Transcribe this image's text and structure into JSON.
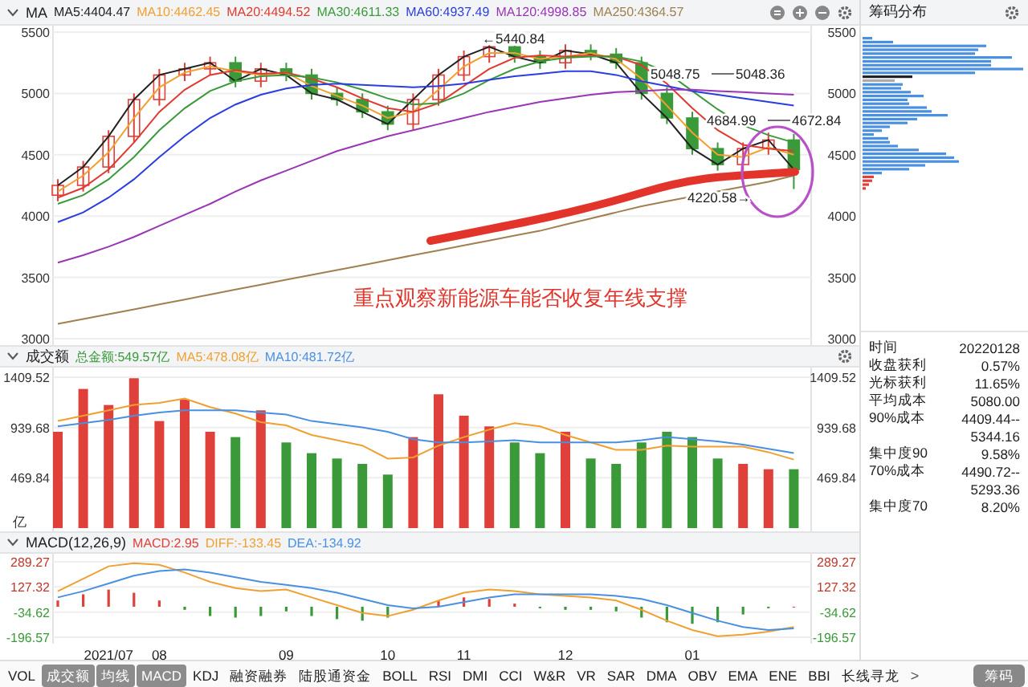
{
  "price_panel": {
    "title": "MA",
    "legend": [
      {
        "text": "MA5:4404.47",
        "color": "#222222"
      },
      {
        "text": "MA10:4462.45",
        "color": "#f0a030"
      },
      {
        "text": "MA20:4494.52",
        "color": "#e03a30"
      },
      {
        "text": "MA30:4611.33",
        "color": "#3a9a3a"
      },
      {
        "text": "MA60:4937.49",
        "color": "#2a3ee0"
      },
      {
        "text": "MA120:4998.85",
        "color": "#9a35b5"
      },
      {
        "text": "MA250:4364.57",
        "color": "#a08050"
      }
    ],
    "price_markers": [
      {
        "texts": [
          "←5440.84"
        ]
      },
      {
        "texts": [
          "5048.75",
          "5048.36"
        ]
      },
      {
        "texts": [
          "4684.99",
          "4672.84"
        ]
      },
      {
        "texts": [
          "4220.58→"
        ]
      }
    ],
    "note": "重点观察新能源车能否收复年线支撑",
    "right_axis_labels": [
      "5500",
      "5000",
      "4500",
      "4000",
      "3500",
      "3000"
    ],
    "chart_data": {
      "type": "candlestick",
      "ylim": [
        3000,
        5500
      ],
      "yticks": [
        5500,
        5000,
        4500,
        4000,
        3500,
        3000
      ],
      "grid": true,
      "ohlc": [
        [
          4170,
          4300,
          4120,
          4250
        ],
        [
          4250,
          4450,
          4200,
          4400
        ],
        [
          4400,
          4700,
          4350,
          4650
        ],
        [
          4650,
          5000,
          4600,
          4950
        ],
        [
          4950,
          5200,
          4900,
          5150
        ],
        [
          5150,
          5250,
          5100,
          5200
        ],
        [
          5200,
          5300,
          5150,
          5250
        ],
        [
          5250,
          5300,
          5050,
          5100
        ],
        [
          5100,
          5250,
          5050,
          5200
        ],
        [
          5200,
          5250,
          5100,
          5150
        ],
        [
          5150,
          5200,
          4950,
          5000
        ],
        [
          5000,
          5050,
          4900,
          4950
        ],
        [
          4950,
          5000,
          4800,
          4850
        ],
        [
          4850,
          4900,
          4700,
          4750
        ],
        [
          4750,
          5000,
          4700,
          4950
        ],
        [
          4950,
          5200,
          4900,
          5150
        ],
        [
          5150,
          5350,
          5100,
          5300
        ],
        [
          5300,
          5440,
          5250,
          5380
        ],
        [
          5380,
          5430,
          5250,
          5300
        ],
        [
          5300,
          5350,
          5200,
          5250
        ],
        [
          5250,
          5400,
          5200,
          5350
        ],
        [
          5350,
          5400,
          5270,
          5320
        ],
        [
          5320,
          5370,
          5200,
          5250
        ],
        [
          5250,
          5300,
          4950,
          5000
        ],
        [
          5000,
          5050,
          4750,
          4800
        ],
        [
          4800,
          4850,
          4500,
          4550
        ],
        [
          4550,
          4600,
          4370,
          4420
        ],
        [
          4420,
          4600,
          4370,
          4550
        ],
        [
          4550,
          4680,
          4500,
          4620
        ],
        [
          4620,
          4670,
          4220,
          4380
        ]
      ],
      "series": [
        {
          "type": "line",
          "color": "#222222",
          "values": [
            4250,
            4400,
            4650,
            4950,
            5150,
            5200,
            5250,
            5100,
            5200,
            5150,
            5000,
            4950,
            4850,
            4750,
            4950,
            5150,
            5300,
            5380,
            5300,
            5250,
            5350,
            5320,
            5250,
            5000,
            4800,
            4550,
            4420,
            4550,
            4620,
            4380
          ]
        },
        {
          "type": "line",
          "color": "#f0a030",
          "values": [
            4200,
            4330,
            4520,
            4800,
            5050,
            5170,
            5220,
            5180,
            5150,
            5170,
            5060,
            4980,
            4900,
            4800,
            4850,
            5030,
            5220,
            5330,
            5330,
            5280,
            5300,
            5330,
            5280,
            5120,
            4900,
            4680,
            4500,
            4480,
            4560,
            4500
          ]
        },
        {
          "type": "line",
          "color": "#e03a30",
          "values": [
            4150,
            4230,
            4380,
            4600,
            4850,
            5030,
            5150,
            5190,
            5160,
            5170,
            5120,
            5050,
            4960,
            4880,
            4850,
            4920,
            5060,
            5200,
            5290,
            5310,
            5300,
            5310,
            5300,
            5230,
            5080,
            4880,
            4700,
            4580,
            4550,
            4530
          ]
        },
        {
          "type": "line",
          "color": "#3a9a3a",
          "values": [
            4100,
            4170,
            4300,
            4480,
            4700,
            4880,
            5020,
            5100,
            5140,
            5150,
            5130,
            5090,
            5030,
            4960,
            4910,
            4920,
            5000,
            5110,
            5200,
            5260,
            5290,
            5300,
            5300,
            5260,
            5170,
            5020,
            4870,
            4740,
            4660,
            4600
          ]
        },
        {
          "type": "line",
          "color": "#2a3ee0",
          "values": [
            3950,
            4030,
            4150,
            4300,
            4480,
            4650,
            4800,
            4910,
            4990,
            5040,
            5070,
            5080,
            5070,
            5060,
            5050,
            5060,
            5080,
            5110,
            5140,
            5160,
            5180,
            5180,
            5150,
            5100,
            5060,
            5020,
            4990,
            4960,
            4930,
            4900
          ]
        },
        {
          "type": "line",
          "color": "#9a35b5",
          "values": [
            3620,
            3680,
            3750,
            3830,
            3920,
            4010,
            4100,
            4200,
            4290,
            4370,
            4450,
            4530,
            4590,
            4650,
            4700,
            4750,
            4800,
            4850,
            4890,
            4930,
            4960,
            4990,
            5010,
            5020,
            5030,
            5030,
            5020,
            5010,
            5000,
            4990
          ]
        },
        {
          "type": "line",
          "color": "#a08050",
          "values": [
            3120,
            3160,
            3200,
            3240,
            3280,
            3320,
            3360,
            3400,
            3440,
            3480,
            3520,
            3560,
            3600,
            3640,
            3680,
            3720,
            3760,
            3800,
            3840,
            3880,
            3930,
            3980,
            4030,
            4080,
            4120,
            4160,
            4200,
            4240,
            4280,
            4330
          ]
        }
      ]
    }
  },
  "volume_panel": {
    "title": "成交额",
    "legend": [
      {
        "text": "总金额:549.57亿",
        "color": "#3a9a3a"
      },
      {
        "text": "MA5:478.08亿",
        "color": "#f0a030"
      },
      {
        "text": "MA10:481.72亿",
        "color": "#4a90e0"
      }
    ],
    "unit": "亿",
    "right_axis_labels": [
      "1409.52",
      "939.68",
      "469.84"
    ],
    "chart_data": {
      "type": "bar",
      "ylim": [
        0,
        1409.52
      ],
      "yticks": [
        1409.52,
        939.68,
        469.84
      ],
      "grid": true,
      "series": [
        {
          "color": "#e0403a",
          "values": [
            900,
            1300,
            1150,
            1400,
            1000,
            1200,
            900,
            null,
            1100,
            null,
            null,
            null,
            null,
            null,
            850,
            1250,
            1050,
            950,
            null,
            null,
            900,
            null,
            null,
            null,
            null,
            null,
            null,
            600,
            550,
            null
          ]
        },
        {
          "color": "#3a9a3a",
          "values": [
            null,
            null,
            null,
            null,
            null,
            null,
            null,
            850,
            null,
            800,
            700,
            650,
            600,
            500,
            null,
            null,
            null,
            null,
            800,
            700,
            null,
            650,
            600,
            800,
            900,
            850,
            650,
            null,
            null,
            550
          ]
        },
        {
          "type": "line",
          "color": "#f0a030",
          "values": [
            1000,
            1050,
            1100,
            1150,
            1170,
            1210,
            1130,
            1070,
            990,
            960,
            870,
            820,
            770,
            650,
            660,
            770,
            850,
            920,
            980,
            950,
            870,
            800,
            730,
            730,
            770,
            760,
            760,
            760,
            710,
            640
          ]
        },
        {
          "type": "line",
          "color": "#4a90e0",
          "values": [
            950,
            980,
            1010,
            1050,
            1080,
            1100,
            1100,
            1100,
            1080,
            1060,
            1000,
            970,
            940,
            900,
            830,
            800,
            800,
            810,
            820,
            800,
            800,
            800,
            800,
            820,
            850,
            830,
            810,
            780,
            740,
            700
          ]
        }
      ]
    }
  },
  "macd_panel": {
    "title": "MACD(12,26,9)",
    "legend": [
      {
        "text": "MACD:2.95",
        "color": "#e0403a"
      },
      {
        "text": "DIFF:-133.45",
        "color": "#f0a030"
      },
      {
        "text": "DEA:-134.92",
        "color": "#4a90e0"
      }
    ],
    "right_axis_labels": [
      "289.27",
      "127.32",
      "-34.62",
      "-196.57"
    ],
    "chart_data": {
      "type": "bar",
      "ylim": [
        -196.57,
        289.27
      ],
      "grid": true,
      "yticks": [
        289.27,
        127.32,
        -34.62,
        -196.57
      ],
      "categories": [
        null,
        null,
        "2021/07",
        null,
        "08",
        null,
        null,
        null,
        null,
        "09",
        null,
        null,
        null,
        "10",
        null,
        null,
        "11",
        null,
        null,
        null,
        "12",
        null,
        null,
        null,
        null,
        "01",
        null,
        null,
        null,
        null
      ],
      "series": [
        {
          "color": "#e0403a",
          "values": [
            40,
            80,
            110,
            90,
            40,
            null,
            null,
            null,
            null,
            null,
            null,
            null,
            null,
            null,
            null,
            40,
            60,
            50,
            20,
            null,
            null,
            null,
            null,
            null,
            null,
            null,
            null,
            null,
            null,
            0
          ]
        },
        {
          "color": "#3a9a3a",
          "values": [
            null,
            null,
            null,
            null,
            null,
            -20,
            -60,
            -70,
            -60,
            -30,
            -60,
            -80,
            -90,
            -70,
            null,
            null,
            null,
            null,
            null,
            -10,
            -20,
            -20,
            -30,
            -70,
            -100,
            -110,
            -100,
            -50,
            -10,
            null
          ]
        },
        {
          "type": "line",
          "color": "#f0a030",
          "values": [
            100,
            180,
            260,
            280,
            270,
            220,
            160,
            120,
            100,
            110,
            60,
            10,
            -40,
            -60,
            -20,
            40,
            90,
            110,
            100,
            80,
            70,
            60,
            40,
            -20,
            -90,
            -150,
            -190,
            -180,
            -160,
            -130
          ]
        },
        {
          "type": "line",
          "color": "#4a90e0",
          "values": [
            60,
            100,
            150,
            200,
            230,
            240,
            220,
            190,
            160,
            140,
            120,
            90,
            50,
            10,
            -10,
            0,
            30,
            60,
            80,
            80,
            80,
            80,
            70,
            50,
            10,
            -40,
            -90,
            -130,
            -150,
            -140
          ]
        }
      ]
    }
  },
  "chip_panel": {
    "title": "筹码分布",
    "stats": [
      {
        "label": "时间",
        "value": "20220128"
      },
      {
        "label": "收盘获利",
        "value": "0.57%"
      },
      {
        "label": "光标获利",
        "value": "11.65%"
      },
      {
        "label": "平均成本",
        "value": "5080.00"
      },
      {
        "label": "90%成本",
        "value": "4409.44--"
      },
      {
        "value": "5344.16"
      },
      {
        "label": "集中度90",
        "value": "9.58%"
      },
      {
        "label": "70%成本",
        "value": "4490.72--"
      },
      {
        "value": "5293.36"
      },
      {
        "label": "集中度70",
        "value": "8.20%"
      }
    ]
  },
  "tabs": [
    {
      "label": "VOL",
      "selected": false
    },
    {
      "label": "成交额",
      "selected": true
    },
    {
      "label": "均线",
      "selected": true
    },
    {
      "label": "MACD",
      "selected": true
    },
    {
      "label": "KDJ",
      "selected": false
    },
    {
      "label": "融资融券",
      "selected": false
    },
    {
      "label": "陆股通资金",
      "selected": false
    },
    {
      "label": "BOLL",
      "selected": false
    },
    {
      "label": "RSI",
      "selected": false
    },
    {
      "label": "DMI",
      "selected": false
    },
    {
      "label": "CCI",
      "selected": false
    },
    {
      "label": "W&R",
      "selected": false
    },
    {
      "label": "VR",
      "selected": false
    },
    {
      "label": "SAR",
      "selected": false
    },
    {
      "label": "DMA",
      "selected": false
    },
    {
      "label": "OBV",
      "selected": false
    },
    {
      "label": "EMA",
      "selected": false
    },
    {
      "label": "ENE",
      "selected": false
    },
    {
      "label": "BBI",
      "selected": false
    },
    {
      "label": "长线寻龙",
      "selected": false
    }
  ],
  "tabs_more": ">",
  "chip_button": {
    "label": "筹码",
    "selected": true
  }
}
